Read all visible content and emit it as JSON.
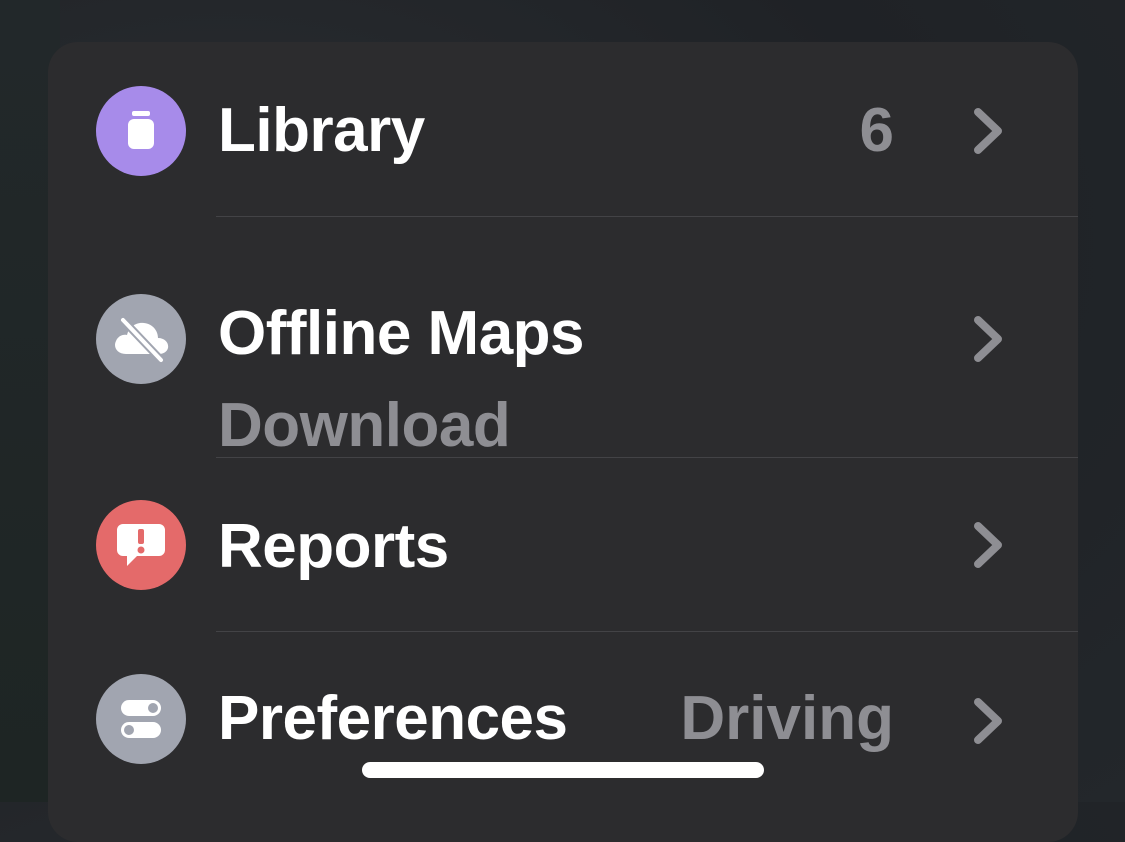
{
  "menu": {
    "items": [
      {
        "id": "library",
        "title": "Library",
        "value": "6",
        "icon": "library-icon",
        "icon_color": "#a78bea"
      },
      {
        "id": "offline-maps",
        "title": "Offline Maps",
        "subtitle": "Download",
        "icon": "cloud-off-icon",
        "icon_color": "#a1a5b0"
      },
      {
        "id": "reports",
        "title": "Reports",
        "icon": "report-alert-icon",
        "icon_color": "#e46a6a"
      },
      {
        "id": "preferences",
        "title": "Preferences",
        "value": "Driving",
        "icon": "toggles-icon",
        "icon_color": "#a1a5b0"
      }
    ]
  },
  "colors": {
    "card_background": "#2c2c2e",
    "primary_text": "#ffffff",
    "secondary_text": "#8e8e93",
    "chevron": "#8e8e93"
  }
}
